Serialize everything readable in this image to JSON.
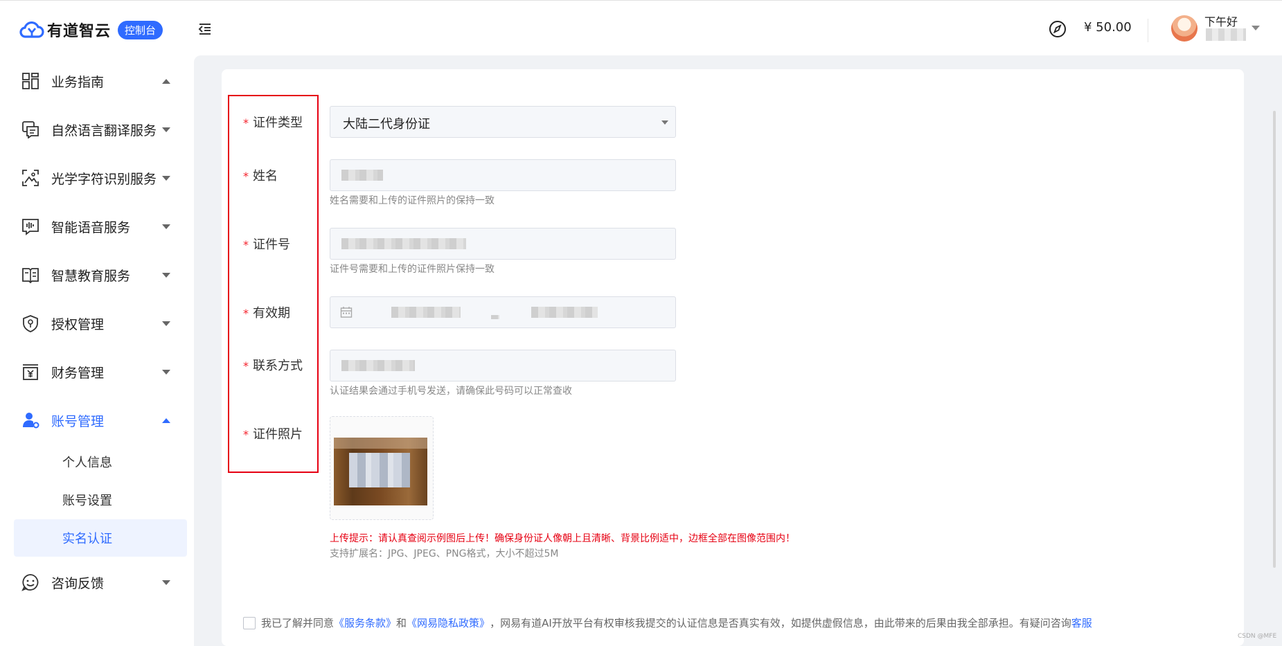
{
  "brand": {
    "logo_text": "有道智云",
    "console_badge": "控制台"
  },
  "header": {
    "balance": "¥ 50.00",
    "greeting": "下午好"
  },
  "sidebar": {
    "items": [
      {
        "label": "业务指南",
        "icon": "grid-icon",
        "caret": "up"
      },
      {
        "label": "自然语言翻译服务",
        "icon": "translate-chat-icon",
        "caret": "down"
      },
      {
        "label": "光学字符识别服务",
        "icon": "image-scan-icon",
        "caret": "down"
      },
      {
        "label": "智能语音服务",
        "icon": "voice-chat-icon",
        "caret": "down"
      },
      {
        "label": "智慧教育服务",
        "icon": "book-icon",
        "caret": "down"
      },
      {
        "label": "授权管理",
        "icon": "shield-icon",
        "caret": "down"
      },
      {
        "label": "财务管理",
        "icon": "finance-icon",
        "caret": "down"
      },
      {
        "label": "账号管理",
        "icon": "user-settings-icon",
        "caret": "up",
        "active": true
      },
      {
        "label": "咨询反馈",
        "icon": "smile-chat-icon",
        "caret": "down"
      }
    ],
    "sub_items": [
      {
        "label": "个人信息"
      },
      {
        "label": "账号设置"
      },
      {
        "label": "实名认证",
        "active": true
      }
    ]
  },
  "form": {
    "id_type": {
      "label": "证件类型",
      "value": "大陆二代身份证"
    },
    "name": {
      "label": "姓名",
      "hint": "姓名需要和上传的证件照片的保持一致"
    },
    "id_number": {
      "label": "证件号",
      "hint": "证件号需要和上传的证件照片保持一致"
    },
    "validity": {
      "label": "有效期"
    },
    "contact": {
      "label": "联系方式",
      "hint": "认证结果会通过手机号发送，请确保此号码可以正常查收"
    },
    "photo": {
      "label": "证件照片"
    },
    "required_mark": "*",
    "upload_warning": "上传提示：请认真查阅示例图后上传！确保身份证人像朝上且清晰、背景比例适中，边框全部在图像范围内！",
    "upload_ext_hint": "支持扩展名：JPG、JPEG、PNG格式，大小不超过5M"
  },
  "agreement": {
    "prefix": "我已了解并同意",
    "terms_link": "《服务条款》",
    "and": "和",
    "privacy_link": "《网易隐私政策》",
    "body": "，网易有道AI开放平台有权审核我提交的认证信息是否真实有效，如提供虚假信息，由此带来的后果由我全部承担。有疑问咨询",
    "support_link": "客服"
  },
  "watermark": "CSDN @MFE",
  "colors": {
    "accent": "#2f6bff",
    "warning": "#e60012",
    "highlight_box": "#e60012"
  }
}
